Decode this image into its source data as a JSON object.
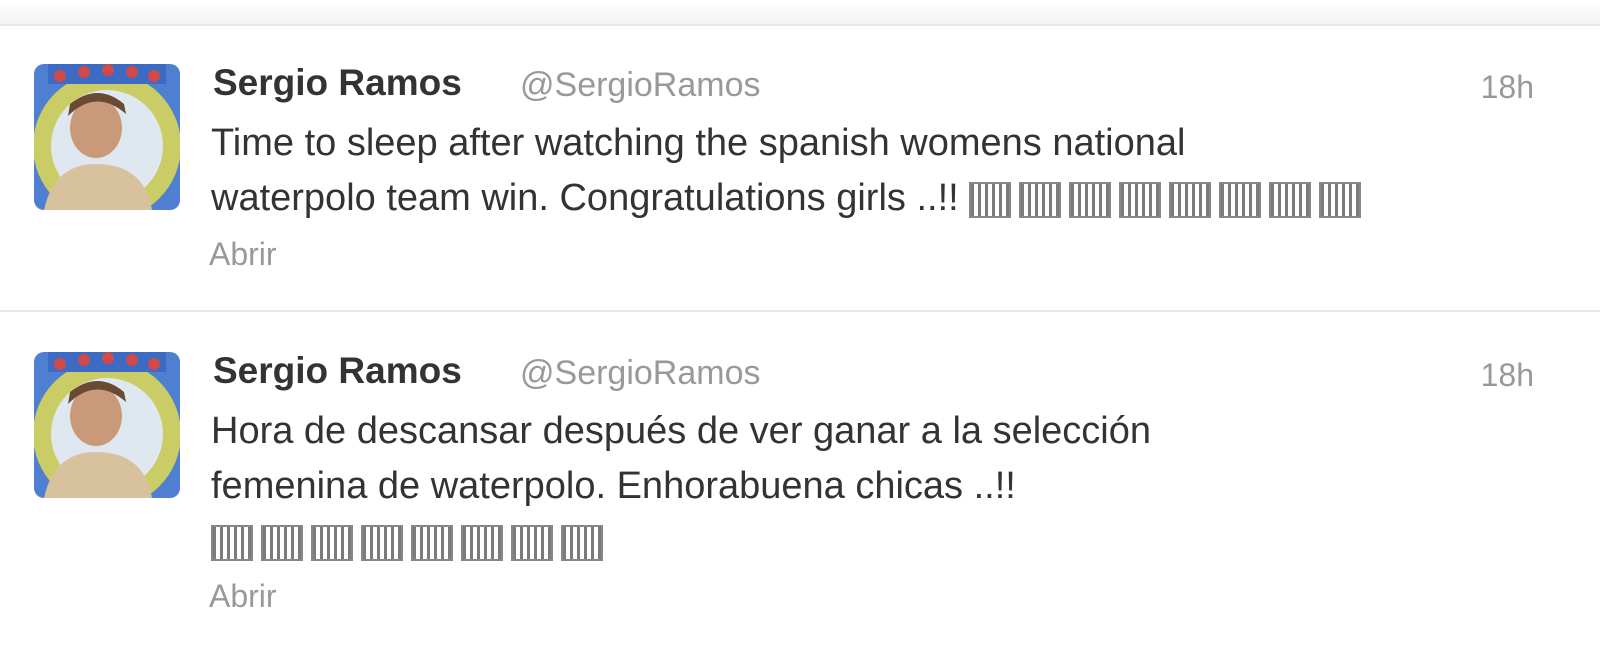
{
  "tweets": [
    {
      "fullname": "Sergio Ramos",
      "username": "@SergioRamos",
      "time": "18h",
      "lines": [
        "Time to sleep after watching the spanish womens national",
        "waterpolo team win. Congratulations girls ..!!"
      ],
      "emoji_icons": [
        "flag-es-icon",
        "flag-es-icon",
        "flag-es-icon",
        "flag-es-icon",
        "flag-es-icon",
        "flag-es-icon",
        "flag-es-icon",
        "flag-es-icon"
      ],
      "open_label": "Abrir"
    },
    {
      "fullname": "Sergio Ramos",
      "username": "@SergioRamos",
      "time": "18h",
      "lines": [
        "Hora de descansar después de ver ganar a la selección",
        "femenina de waterpolo. Enhorabuena chicas ..!!"
      ],
      "emoji_icons": [
        "flag-es-icon",
        "flag-es-icon",
        "flag-es-icon",
        "flag-es-icon",
        "flag-es-icon",
        "flag-es-icon",
        "flag-es-icon",
        "flag-es-icon"
      ],
      "open_label": "Abrir"
    }
  ],
  "colors": {
    "name": "#333333",
    "muted": "#999999",
    "divider": "#e8e8e8"
  }
}
